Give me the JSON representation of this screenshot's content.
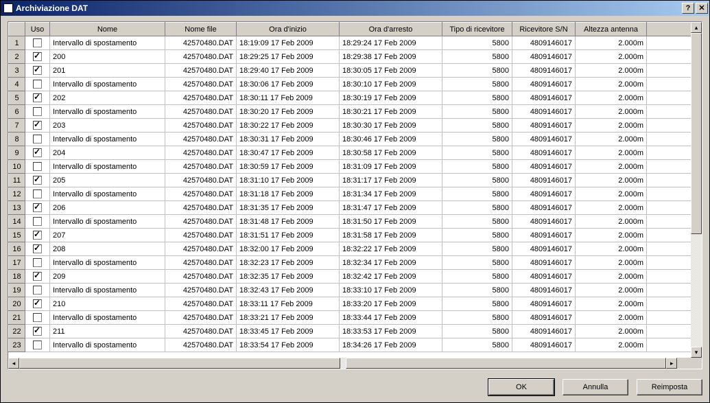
{
  "window": {
    "title": "Archiviazione DAT"
  },
  "columns": {
    "uso": "Uso",
    "nome": "Nome",
    "file": "Nome file",
    "start": "Ora d'inizio",
    "stop": "Ora d'arresto",
    "tipo": "Tipo di ricevitore",
    "sn": "Ricevitore S/N",
    "alt": "Altezza antenna"
  },
  "rows": [
    {
      "n": "1",
      "uso": false,
      "nome": "Intervallo di spostamento",
      "file": "42570480.DAT",
      "start": "18:19:09 17 Feb 2009",
      "stop": "18:29:24 17 Feb 2009",
      "tipo": "5800",
      "sn": "4809146017",
      "alt": "2.000m"
    },
    {
      "n": "2",
      "uso": true,
      "nome": "200",
      "file": "42570480.DAT",
      "start": "18:29:25 17 Feb 2009",
      "stop": "18:29:38 17 Feb 2009",
      "tipo": "5800",
      "sn": "4809146017",
      "alt": "2.000m"
    },
    {
      "n": "3",
      "uso": true,
      "nome": "201",
      "file": "42570480.DAT",
      "start": "18:29:40 17 Feb 2009",
      "stop": "18:30:05 17 Feb 2009",
      "tipo": "5800",
      "sn": "4809146017",
      "alt": "2.000m"
    },
    {
      "n": "4",
      "uso": false,
      "nome": "Intervallo di spostamento",
      "file": "42570480.DAT",
      "start": "18:30:06 17 Feb 2009",
      "stop": "18:30:10 17 Feb 2009",
      "tipo": "5800",
      "sn": "4809146017",
      "alt": "2.000m"
    },
    {
      "n": "5",
      "uso": true,
      "nome": "202",
      "file": "42570480.DAT",
      "start": "18:30:11 17 Feb 2009",
      "stop": "18:30:19 17 Feb 2009",
      "tipo": "5800",
      "sn": "4809146017",
      "alt": "2.000m"
    },
    {
      "n": "6",
      "uso": false,
      "nome": "Intervallo di spostamento",
      "file": "42570480.DAT",
      "start": "18:30:20 17 Feb 2009",
      "stop": "18:30:21 17 Feb 2009",
      "tipo": "5800",
      "sn": "4809146017",
      "alt": "2.000m"
    },
    {
      "n": "7",
      "uso": true,
      "nome": "203",
      "file": "42570480.DAT",
      "start": "18:30:22 17 Feb 2009",
      "stop": "18:30:30 17 Feb 2009",
      "tipo": "5800",
      "sn": "4809146017",
      "alt": "2.000m"
    },
    {
      "n": "8",
      "uso": false,
      "nome": "Intervallo di spostamento",
      "file": "42570480.DAT",
      "start": "18:30:31 17 Feb 2009",
      "stop": "18:30:46 17 Feb 2009",
      "tipo": "5800",
      "sn": "4809146017",
      "alt": "2.000m"
    },
    {
      "n": "9",
      "uso": true,
      "nome": "204",
      "file": "42570480.DAT",
      "start": "18:30:47 17 Feb 2009",
      "stop": "18:30:58 17 Feb 2009",
      "tipo": "5800",
      "sn": "4809146017",
      "alt": "2.000m"
    },
    {
      "n": "10",
      "uso": false,
      "nome": "Intervallo di spostamento",
      "file": "42570480.DAT",
      "start": "18:30:59 17 Feb 2009",
      "stop": "18:31:09 17 Feb 2009",
      "tipo": "5800",
      "sn": "4809146017",
      "alt": "2.000m"
    },
    {
      "n": "11",
      "uso": true,
      "nome": "205",
      "file": "42570480.DAT",
      "start": "18:31:10 17 Feb 2009",
      "stop": "18:31:17 17 Feb 2009",
      "tipo": "5800",
      "sn": "4809146017",
      "alt": "2.000m"
    },
    {
      "n": "12",
      "uso": false,
      "nome": "Intervallo di spostamento",
      "file": "42570480.DAT",
      "start": "18:31:18 17 Feb 2009",
      "stop": "18:31:34 17 Feb 2009",
      "tipo": "5800",
      "sn": "4809146017",
      "alt": "2.000m"
    },
    {
      "n": "13",
      "uso": true,
      "nome": "206",
      "file": "42570480.DAT",
      "start": "18:31:35 17 Feb 2009",
      "stop": "18:31:47 17 Feb 2009",
      "tipo": "5800",
      "sn": "4809146017",
      "alt": "2.000m"
    },
    {
      "n": "14",
      "uso": false,
      "nome": "Intervallo di spostamento",
      "file": "42570480.DAT",
      "start": "18:31:48 17 Feb 2009",
      "stop": "18:31:50 17 Feb 2009",
      "tipo": "5800",
      "sn": "4809146017",
      "alt": "2.000m"
    },
    {
      "n": "15",
      "uso": true,
      "nome": "207",
      "file": "42570480.DAT",
      "start": "18:31:51 17 Feb 2009",
      "stop": "18:31:58 17 Feb 2009",
      "tipo": "5800",
      "sn": "4809146017",
      "alt": "2.000m"
    },
    {
      "n": "16",
      "uso": true,
      "nome": "208",
      "file": "42570480.DAT",
      "start": "18:32:00 17 Feb 2009",
      "stop": "18:32:22 17 Feb 2009",
      "tipo": "5800",
      "sn": "4809146017",
      "alt": "2.000m"
    },
    {
      "n": "17",
      "uso": false,
      "nome": "Intervallo di spostamento",
      "file": "42570480.DAT",
      "start": "18:32:23 17 Feb 2009",
      "stop": "18:32:34 17 Feb 2009",
      "tipo": "5800",
      "sn": "4809146017",
      "alt": "2.000m"
    },
    {
      "n": "18",
      "uso": true,
      "nome": "209",
      "file": "42570480.DAT",
      "start": "18:32:35 17 Feb 2009",
      "stop": "18:32:42 17 Feb 2009",
      "tipo": "5800",
      "sn": "4809146017",
      "alt": "2.000m"
    },
    {
      "n": "19",
      "uso": false,
      "nome": "Intervallo di spostamento",
      "file": "42570480.DAT",
      "start": "18:32:43 17 Feb 2009",
      "stop": "18:33:10 17 Feb 2009",
      "tipo": "5800",
      "sn": "4809146017",
      "alt": "2.000m"
    },
    {
      "n": "20",
      "uso": true,
      "nome": "210",
      "file": "42570480.DAT",
      "start": "18:33:11 17 Feb 2009",
      "stop": "18:33:20 17 Feb 2009",
      "tipo": "5800",
      "sn": "4809146017",
      "alt": "2.000m"
    },
    {
      "n": "21",
      "uso": false,
      "nome": "Intervallo di spostamento",
      "file": "42570480.DAT",
      "start": "18:33:21 17 Feb 2009",
      "stop": "18:33:44 17 Feb 2009",
      "tipo": "5800",
      "sn": "4809146017",
      "alt": "2.000m"
    },
    {
      "n": "22",
      "uso": true,
      "nome": "211",
      "file": "42570480.DAT",
      "start": "18:33:45 17 Feb 2009",
      "stop": "18:33:53 17 Feb 2009",
      "tipo": "5800",
      "sn": "4809146017",
      "alt": "2.000m"
    },
    {
      "n": "23",
      "uso": false,
      "nome": "Intervallo di spostamento",
      "file": "42570480.DAT",
      "start": "18:33:54 17 Feb 2009",
      "stop": "18:34:26 17 Feb 2009",
      "tipo": "5800",
      "sn": "4809146017",
      "alt": "2.000m"
    }
  ],
  "buttons": {
    "ok": "OK",
    "cancel": "Annulla",
    "reset": "Reimposta"
  }
}
